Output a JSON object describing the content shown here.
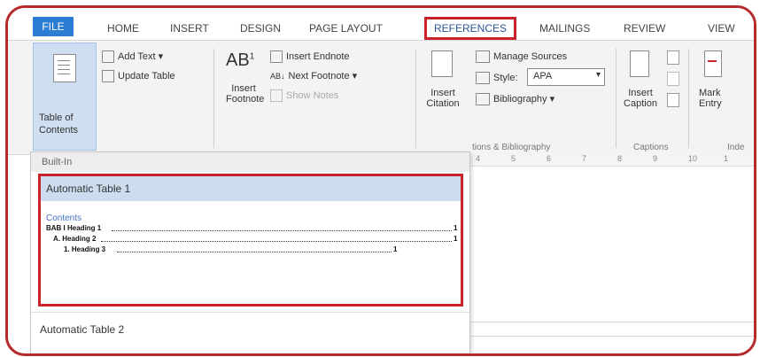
{
  "tabs": {
    "file": "FILE",
    "home": "HOME",
    "insert": "INSERT",
    "design": "DESIGN",
    "page_layout": "PAGE LAYOUT",
    "references": "REFERENCES",
    "mailings": "MAILINGS",
    "review": "REVIEW",
    "view": "VIEW"
  },
  "ribbon": {
    "toc_button": "Table of Contents",
    "toc_line1": "Table of",
    "toc_line2": "Contents",
    "add_text": "Add Text",
    "update_table": "Update Table",
    "insert_footnote_line1": "Insert",
    "insert_footnote_line2": "Footnote",
    "insert_endnote": "Insert Endnote",
    "next_footnote": "Next Footnote",
    "show_notes": "Show Notes",
    "insert_citation_line1": "Insert",
    "insert_citation_line2": "Citation",
    "manage_sources": "Manage Sources",
    "style_label": "Style:",
    "style_value": "APA",
    "bibliography": "Bibliography",
    "group_citations": "tions & Bibliography",
    "insert_caption_line1": "Insert",
    "insert_caption_line2": "Caption",
    "group_captions": "Captions",
    "mark_entry_line1": "Mark",
    "mark_entry_line2": "Entry",
    "group_index": "Inde"
  },
  "dropdown": {
    "header": "Built-In",
    "auto1_title": "Automatic Table 1",
    "contents_label": "Contents",
    "toc_lines": [
      {
        "text": "BAB I    Heading 1",
        "page": "1"
      },
      {
        "text": "A.   Heading 2",
        "page": "1"
      },
      {
        "text": "1.   Heading 3",
        "page": "1"
      }
    ],
    "auto2_title": "Automatic Table 2"
  },
  "ruler": [
    "4",
    "5",
    "6",
    "7",
    "8",
    "9",
    "10",
    "1"
  ],
  "colors": {
    "frame": "#b52a2a",
    "highlight": "#c8232b",
    "file_tab": "#2b7cd3",
    "selected": "#cddcee"
  }
}
